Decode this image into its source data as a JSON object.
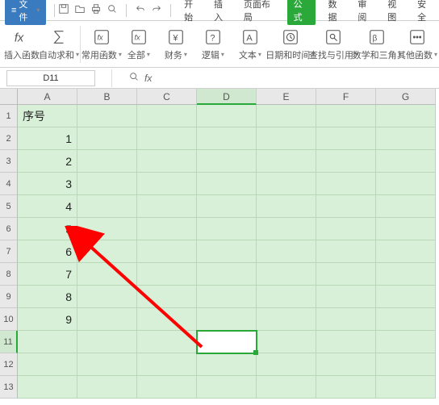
{
  "menubar": {
    "file_label": "文件",
    "tabs": [
      "开始",
      "插入",
      "页面布局",
      "公式",
      "数据",
      "审阅",
      "视图",
      "安全"
    ],
    "active_tab": 3
  },
  "ribbon": {
    "items": [
      {
        "label": "插入函数",
        "icon": "fx"
      },
      {
        "label": "自动求和",
        "icon": "sigma",
        "dd": true
      },
      {
        "label": "常用函数",
        "icon": "star-fn",
        "dd": true
      },
      {
        "label": "全部",
        "icon": "all-fn",
        "dd": true
      },
      {
        "label": "财务",
        "icon": "money-fn",
        "dd": true
      },
      {
        "label": "逻辑",
        "icon": "q-fn",
        "dd": true
      },
      {
        "label": "文本",
        "icon": "text-fn",
        "dd": true
      },
      {
        "label": "日期和时间",
        "icon": "clock-fn",
        "dd": true
      },
      {
        "label": "查找与引用",
        "icon": "search-fn",
        "dd": true
      },
      {
        "label": "数学和三角",
        "icon": "math-fn",
        "dd": true
      },
      {
        "label": "其他函数",
        "icon": "more-fn",
        "dd": true
      }
    ]
  },
  "cellbar": {
    "name_box": "D11",
    "formula": ""
  },
  "sheet": {
    "columns": [
      "A",
      "B",
      "C",
      "D",
      "E",
      "F",
      "G"
    ],
    "total_rows": 13,
    "sel_col": 3,
    "sel_row": 10,
    "rows": [
      {
        "A": "序号"
      },
      {
        "A": "1"
      },
      {
        "A": "2"
      },
      {
        "A": "3"
      },
      {
        "A": "4"
      },
      {
        "A": "5"
      },
      {
        "A": "6"
      },
      {
        "A": "7"
      },
      {
        "A": "8"
      },
      {
        "A": "9"
      },
      {},
      {},
      {}
    ]
  }
}
